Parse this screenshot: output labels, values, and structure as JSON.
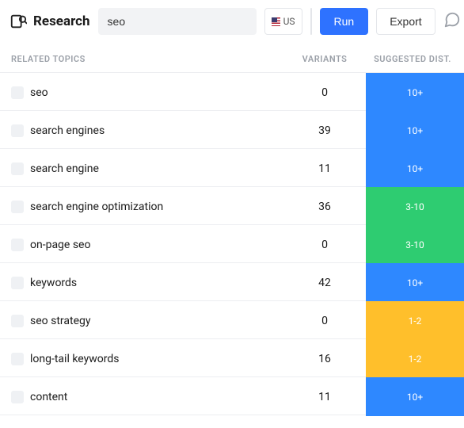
{
  "header": {
    "title": "Research",
    "search_value": "seo",
    "region_label": "US",
    "run_label": "Run",
    "export_label": "Export"
  },
  "columns": {
    "topics": "Related Topics",
    "variants": "Variants",
    "suggested": "Suggested Dist."
  },
  "dist_labels": {
    "many": "10+",
    "mid": "3-10",
    "few": "1-2"
  },
  "rows": [
    {
      "topic": "seo",
      "variants": 0,
      "dist": "many"
    },
    {
      "topic": "search engines",
      "variants": 39,
      "dist": "many"
    },
    {
      "topic": "search engine",
      "variants": 11,
      "dist": "many"
    },
    {
      "topic": "search engine optimization",
      "variants": 36,
      "dist": "mid"
    },
    {
      "topic": "on-page seo",
      "variants": 0,
      "dist": "mid"
    },
    {
      "topic": "keywords",
      "variants": 42,
      "dist": "many"
    },
    {
      "topic": "seo strategy",
      "variants": 0,
      "dist": "few"
    },
    {
      "topic": "long-tail keywords",
      "variants": 16,
      "dist": "few"
    },
    {
      "topic": "content",
      "variants": 11,
      "dist": "many"
    }
  ]
}
